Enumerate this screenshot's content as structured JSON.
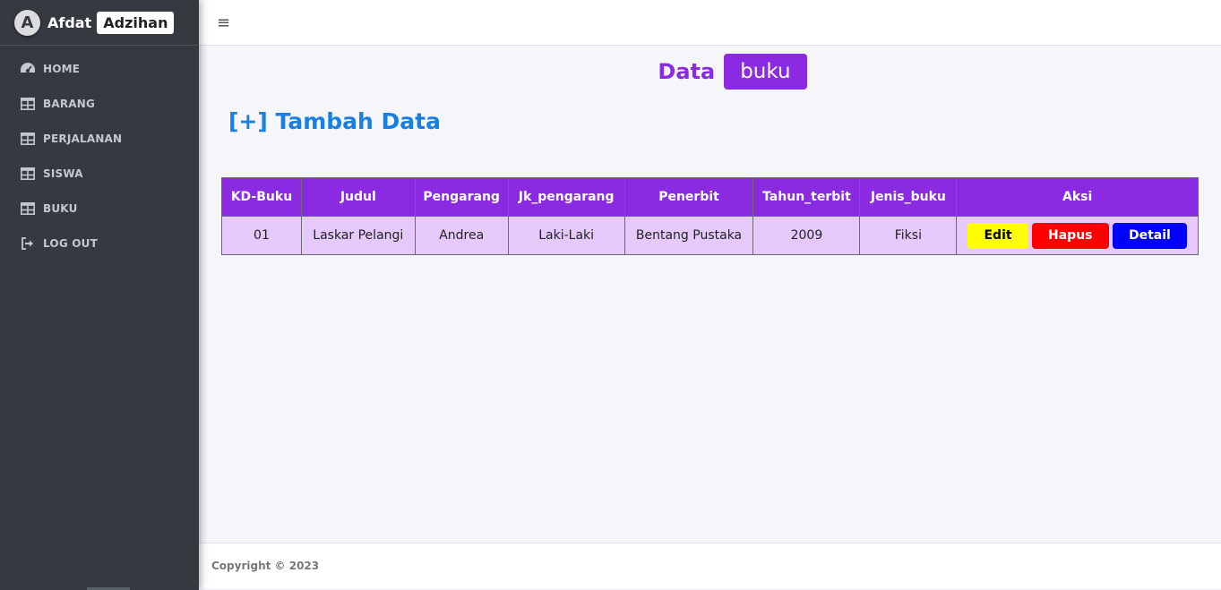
{
  "brand": {
    "logo_letter": "A",
    "name": "Afdat",
    "badge": "Adzihan"
  },
  "sidebar": {
    "items": [
      {
        "icon": "dashboard-icon",
        "label": "HOME"
      },
      {
        "icon": "table-icon",
        "label": "BARANG"
      },
      {
        "icon": "table-icon",
        "label": "PERJALANAN"
      },
      {
        "icon": "table-icon",
        "label": "SISWA"
      },
      {
        "icon": "table-icon",
        "label": "BUKU"
      },
      {
        "icon": "logout-icon",
        "label": "LOG OUT"
      }
    ]
  },
  "topbar": {
    "menu_icon": "hamburger-icon",
    "menu_glyph": "≡"
  },
  "page": {
    "title": "Data",
    "badge": "buku",
    "add_link": "[+] Tambah Data"
  },
  "table": {
    "headers": [
      "KD-Buku",
      "Judul",
      "Pengarang",
      "Jk_pengarang",
      "Penerbit",
      "Tahun_terbit",
      "Jenis_buku",
      "Aksi"
    ],
    "rows": [
      [
        "01",
        "Laskar Pelangi",
        "Andrea",
        "Laki-Laki",
        "Bentang Pustaka",
        "2009",
        "Fiksi"
      ]
    ],
    "actions": {
      "edit": "Edit",
      "hapus": "Hapus",
      "detail": "Detail"
    }
  },
  "colors": {
    "accent": "#8a2be2",
    "row_bg": "#e5c9fb",
    "link": "#1a7fe0",
    "sidebar_bg": "#343a40",
    "edit": "#ffff00",
    "hapus": "#ff0000",
    "detail": "#0000ff"
  },
  "footer": {
    "copyright": "Copyright © 2023"
  }
}
